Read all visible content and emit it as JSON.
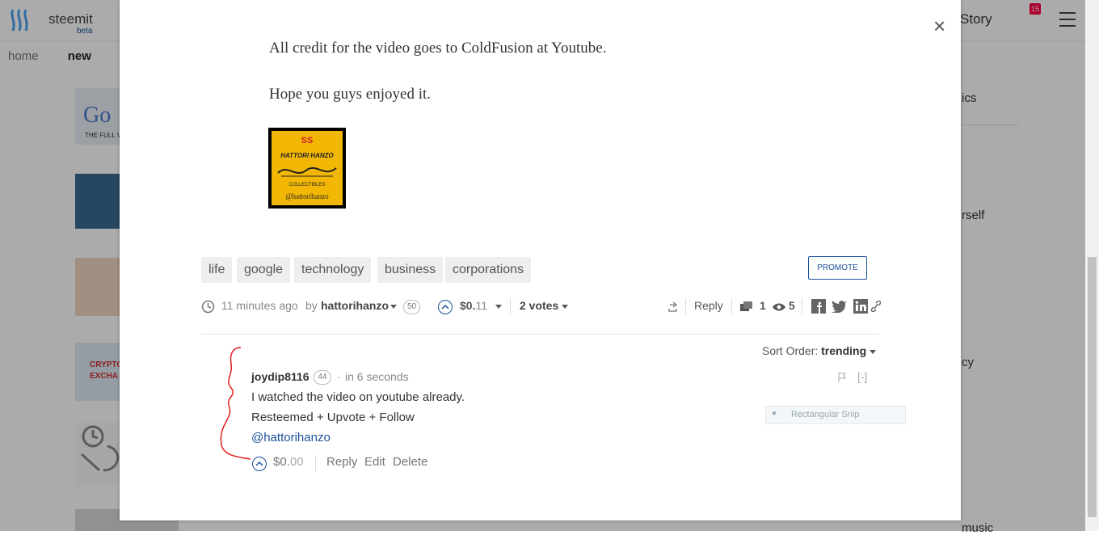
{
  "background": {
    "brand": "steemit",
    "beta": "beta",
    "story_label": "Story",
    "notification_count": "15",
    "nav": [
      "home",
      "new"
    ],
    "sidebar_fragments": [
      "ics",
      "rself",
      "cy",
      "music"
    ],
    "thumb_text": [
      "Go",
      "THE FULL V",
      "CRYPTO",
      "EXCHA"
    ]
  },
  "modal": {
    "close_label": "×",
    "paragraphs": [
      "All credit for the video goes to ColdFusion at Youtube.",
      "Hope you guys enjoyed it."
    ],
    "signature": {
      "handle": "@hattorihanzo",
      "title": "HATTORI HANZO",
      "sub": "COLLECTIBLES",
      "steem_mark": "SS"
    },
    "tags": [
      "life",
      "google",
      "technology",
      "business",
      "corporations"
    ],
    "promote_label": "PROMOTE",
    "meta": {
      "time": "11 minutes ago",
      "by": "by",
      "author": "hattorihanzo",
      "reputation": "50",
      "payout_main": "$0.",
      "payout_cents": "11",
      "votes": "2 votes",
      "reply_label": "Reply",
      "comment_count": "1",
      "view_count": "5"
    },
    "sort": {
      "label": "Sort Order:",
      "value": "trending"
    },
    "comment": {
      "author": "joydip8116",
      "reputation": "44",
      "dot": "·",
      "time": "in 6 seconds",
      "collapse": "[-]",
      "lines": [
        "I watched the video on youtube already.",
        "Resteemed + Upvote + Follow"
      ],
      "mention": "@hattorihanzo",
      "payout_main": "$0.",
      "payout_cents": "00",
      "actions": [
        "Reply",
        "Edit",
        "Delete"
      ]
    },
    "snip_label": "Rectangular Snip"
  },
  "colors": {
    "link": "#1a5099",
    "annotation": "#e02020",
    "signature_bg": "#f2b705"
  }
}
